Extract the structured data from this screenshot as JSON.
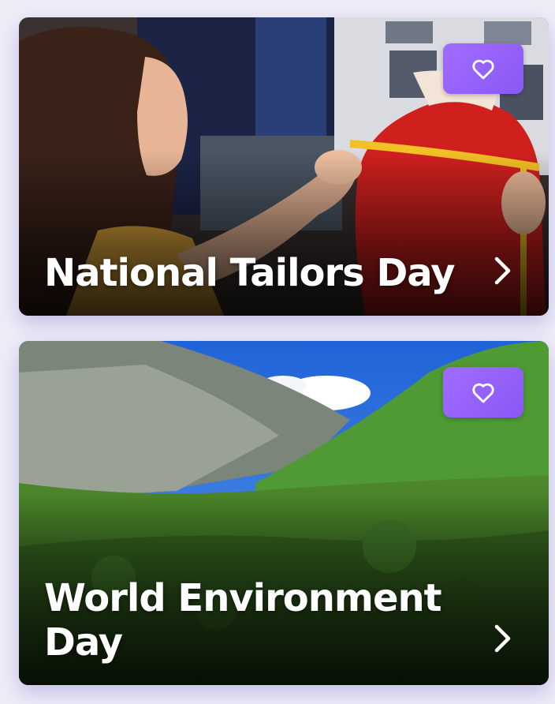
{
  "cards": [
    {
      "title": "National Tailors Day",
      "photo": "tailor-measuring-dress-form",
      "favorite_icon": "heart-outline-icon",
      "open_icon": "chevron-right-icon"
    },
    {
      "title": "World Environment Day",
      "photo": "green-mountain-valley",
      "favorite_icon": "heart-outline-icon",
      "open_icon": "chevron-right-icon"
    }
  ],
  "colors": {
    "background": "#eeedf7",
    "favorite_button": "#9a66fb",
    "title_text": "#ffffff"
  }
}
